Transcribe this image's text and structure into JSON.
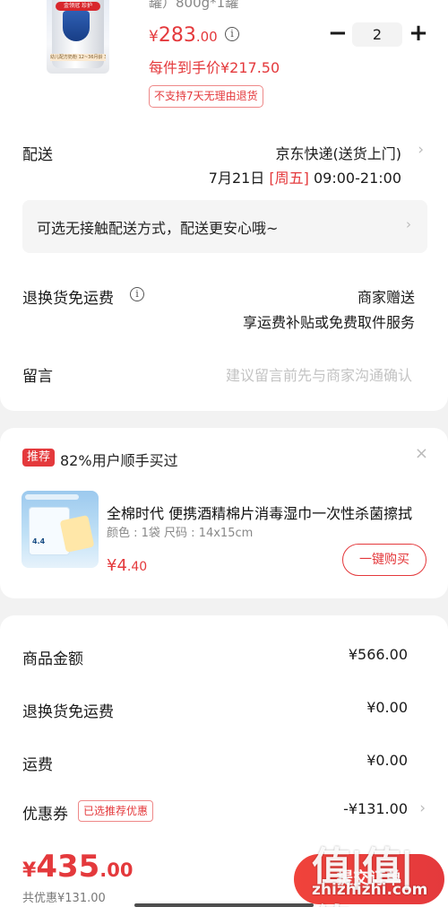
{
  "product": {
    "title_partial": "罐）800g*1罐",
    "price_currency": "¥",
    "price_int": "283",
    "price_dec": ".00",
    "quantity": "2",
    "minus_label": "−",
    "plus_label": "+",
    "unit_price": "每件到手价¥217.50",
    "return_policy": "不支持7天无理由退货",
    "image_badge": "金领冠 珍护",
    "image_band": "幼儿配方奶粉 12~36月龄 3段"
  },
  "delivery": {
    "label": "配送",
    "carrier": "京东快递(送货上门)",
    "date": "7月21日",
    "weekday": "[周五]",
    "time": "09:00-21:00",
    "contactless_notice": "可选无接触配送方式，配送更安心哦~"
  },
  "return_shipping": {
    "label": "退换货免运费",
    "value": "商家赠送",
    "detail": "享运费补贴或免费取件服务"
  },
  "remark": {
    "label": "留言",
    "placeholder": "建议留言前先与商家沟通确认"
  },
  "recommend": {
    "badge": "推荐",
    "title": "82%用户顺手买过",
    "close": "×",
    "item_name": "全棉时代 便携酒精棉片消毒湿巾一次性杀菌擦拭",
    "item_spec": "颜色 : 1袋   尺码 : 14x15cm",
    "item_price_cur": "¥",
    "item_price_int": "4",
    "item_price_dec": ".40",
    "buy_label": "一键购买",
    "image_price": "4.4"
  },
  "summary": {
    "rows": [
      {
        "label": "商品金额",
        "value": "¥566.00"
      },
      {
        "label": "退换货免运费",
        "value": "¥0.00"
      },
      {
        "label": "运费",
        "value": "¥0.00"
      },
      {
        "label": "优惠券",
        "value": "-¥131.00"
      }
    ],
    "coupon_tag": "已选推荐优惠"
  },
  "checkout": {
    "total_cur": "¥",
    "total_int": "435",
    "total_dec": ".00",
    "discount": "共优惠¥131.00",
    "submit_label": "提交订单"
  },
  "watermark": {
    "top": "值|值|值",
    "bottom": "zhizhizhi.com"
  },
  "colors": {
    "accent": "#e4393c",
    "background": "#f2f2f2"
  },
  "icons": [
    "info-icon",
    "chevron-right-icon",
    "close-icon"
  ]
}
